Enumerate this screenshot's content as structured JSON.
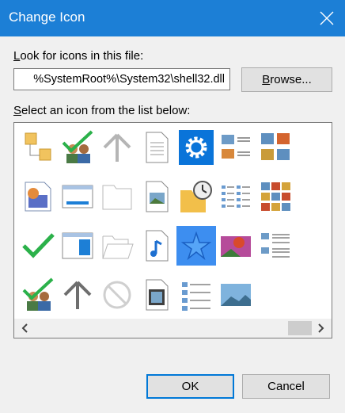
{
  "window": {
    "title": "Change Icon"
  },
  "lookfor": {
    "label_pre": "",
    "label_accel": "L",
    "label_post": "ook for icons in this file:",
    "path_value": "%SystemRoot%\\System32\\shell32.dll"
  },
  "browse_button": {
    "label_accel": "B",
    "label_post": "rowse..."
  },
  "select": {
    "label_accel": "S",
    "label_post": "elect an icon from the list below:"
  },
  "icons": {
    "grid": [
      [
        "folders-icon",
        "users-check-icon",
        "up-arrow-gray-icon",
        "document-icon",
        "gear-settings-icon",
        "image-list-icon",
        "photo-grid-icon"
      ],
      [
        "media-file-icon",
        "window-icon",
        "folder-outline-icon",
        "image-file-icon",
        "folder-clock-icon",
        "details-list-icon",
        "photo-tiles-icon"
      ],
      [
        "green-checkmark-icon",
        "window-sidebar-icon",
        "folder-open-outline-icon",
        "audio-file-icon",
        "star-favorite-icon",
        "hot-air-balloon-photo-icon",
        "list-lines-icon"
      ],
      [
        "users-check-icon",
        "up-arrow-dark-icon",
        "no-entry-icon",
        "video-file-icon",
        "content-list-icon",
        "landscape-photo-icon",
        ""
      ]
    ],
    "selected": "star-favorite-icon"
  },
  "scrollbar": {
    "left_arrow": "chevron-left-icon",
    "right_arrow": "chevron-right-icon"
  },
  "buttons": {
    "ok": "OK",
    "cancel": "Cancel"
  },
  "colors": {
    "titlebar": "#1c7fd6",
    "selection": "#3d8ef0",
    "accent_border": "#0078d7"
  }
}
